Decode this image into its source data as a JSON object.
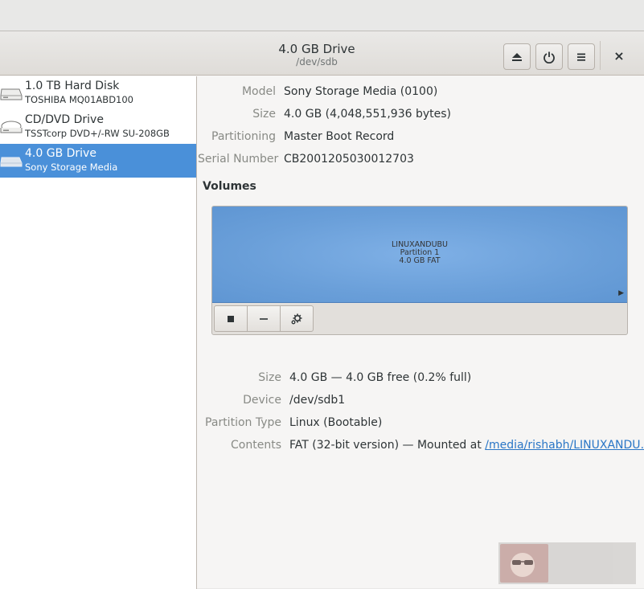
{
  "header": {
    "title": "4.0 GB Drive",
    "subtitle": "/dev/sdb",
    "buttons": {
      "eject_icon": "eject-icon",
      "power_icon": "power-icon",
      "menu_icon": "hamburger-menu-icon",
      "close_label": "×"
    }
  },
  "sidebar": {
    "items": [
      {
        "name": "1.0 TB Hard Disk",
        "detail": "TOSHIBA MQ01ABD100",
        "icon": "hard-disk-icon",
        "selected": false
      },
      {
        "name": "CD/DVD Drive",
        "detail": "TSSTcorp DVD+/-RW SU-208GB",
        "icon": "optical-drive-icon",
        "selected": false
      },
      {
        "name": "4.0 GB Drive",
        "detail": "Sony Storage Media",
        "icon": "usb-drive-icon",
        "selected": true
      }
    ]
  },
  "drive": {
    "model_label": "Model",
    "model_value": "Sony Storage Media (0100)",
    "size_label": "Size",
    "size_value": "4.0 GB (4,048,551,936 bytes)",
    "partitioning_label": "Partitioning",
    "partitioning_value": "Master Boot Record",
    "serial_label": "Serial Number",
    "serial_value": "CB2001205030012703"
  },
  "volumes": {
    "heading": "Volumes",
    "partition": {
      "label": "LINUXANDUBU",
      "number": "Partition 1",
      "desc": "4.0 GB FAT"
    },
    "toolbar": {
      "stop_icon": "stop-icon",
      "remove_icon": "minus-icon",
      "settings_icon": "gears-icon"
    },
    "details": {
      "size_label": "Size",
      "size_value": "4.0 GB — 4.0 GB free (0.2% full)",
      "device_label": "Device",
      "device_value": "/dev/sdb1",
      "ptype_label": "Partition Type",
      "ptype_value": "Linux (Bootable)",
      "contents_label": "Contents",
      "contents_prefix": "FAT (32-bit version) — Mounted at ",
      "contents_link": "/media/rishabh/LINUXANDU…"
    }
  },
  "colors": {
    "selection": "#4a90d9",
    "partition": "#6a9fd9",
    "link": "#2a76c6"
  }
}
